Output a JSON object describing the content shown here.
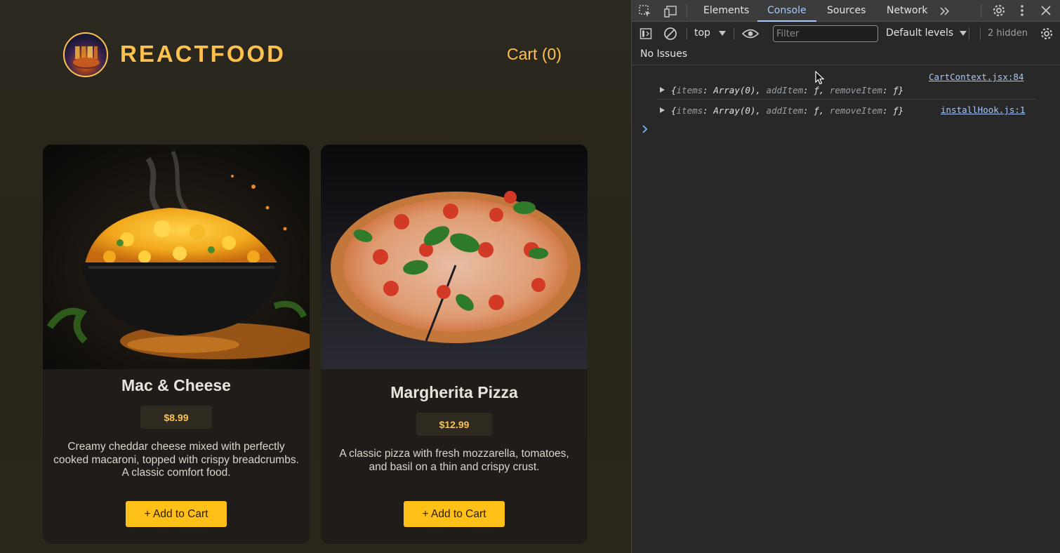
{
  "app": {
    "title": "REACTFOOD",
    "cart_label": "Cart (0)",
    "meals": [
      {
        "name": "Mac & Cheese",
        "price": "$8.99",
        "description": "Creamy cheddar cheese mixed with perfectly cooked macaroni, topped with crispy breadcrumbs. A classic comfort food.",
        "button_label": "+ Add to Cart"
      },
      {
        "name": "Margherita Pizza",
        "price": "$12.99",
        "description": "A classic pizza with fresh mozzarella, tomatoes, and basil on a thin and crispy crust.",
        "button_label": "+ Add to Cart"
      }
    ]
  },
  "devtools": {
    "tabs": [
      "Elements",
      "Console",
      "Sources",
      "Network"
    ],
    "active_tab": "Console",
    "toolbar": {
      "context": "top",
      "filter_placeholder": "Filter",
      "levels": "Default levels",
      "hidden_count": "2 hidden"
    },
    "issues": "No Issues",
    "logs": [
      {
        "source": "CartContext.jsx:84",
        "parts": [
          {
            "text": "{",
            "dim": false
          },
          {
            "text": "items",
            "dim": true
          },
          {
            "text": ": Array(0), ",
            "dim": false
          },
          {
            "text": "addItem",
            "dim": true
          },
          {
            "text": ": ƒ, ",
            "dim": false
          },
          {
            "text": "removeItem",
            "dim": true
          },
          {
            "text": ": ƒ}",
            "dim": false
          }
        ]
      },
      {
        "source": "installHook.js:1",
        "parts": [
          {
            "text": "{",
            "dim": false
          },
          {
            "text": "items",
            "dim": true
          },
          {
            "text": ": Array(0), ",
            "dim": false
          },
          {
            "text": "addItem",
            "dim": true
          },
          {
            "text": ": ƒ, ",
            "dim": false
          },
          {
            "text": "removeItem",
            "dim": true
          },
          {
            "text": ": ƒ}",
            "dim": false
          }
        ]
      }
    ],
    "colors": {
      "accent": "#a8c7fa",
      "brand": "#ffc14d",
      "button": "#ffc017"
    }
  }
}
